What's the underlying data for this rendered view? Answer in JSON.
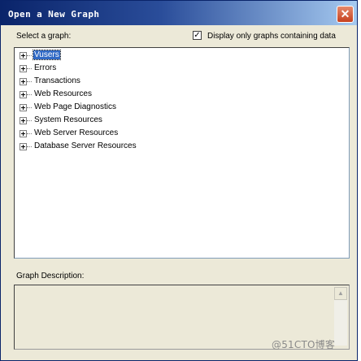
{
  "window": {
    "title": "Open a New Graph",
    "close_icon": "close-icon"
  },
  "selector": {
    "label": "Select a graph:",
    "filter_checkbox": {
      "checked": true,
      "mark": "✓",
      "label": "Display only graphs containing data"
    }
  },
  "tree": {
    "items": [
      {
        "label": "Vusers",
        "selected": true
      },
      {
        "label": "Errors",
        "selected": false
      },
      {
        "label": "Transactions",
        "selected": false
      },
      {
        "label": "Web Resources",
        "selected": false
      },
      {
        "label": "Web Page Diagnostics",
        "selected": false
      },
      {
        "label": "System Resources",
        "selected": false
      },
      {
        "label": "Web Server Resources",
        "selected": false
      },
      {
        "label": "Database Server Resources",
        "selected": false
      }
    ]
  },
  "description": {
    "label": "Graph Description:",
    "text": "",
    "scroll_up_glyph": "▲"
  },
  "watermark": "@51CTO博客",
  "colors": {
    "titlebar_start": "#0a246a",
    "titlebar_end": "#a6caf0",
    "selection": "#316ac5",
    "close_button": "#c6401f",
    "dialog_bg": "#ece9d8"
  }
}
